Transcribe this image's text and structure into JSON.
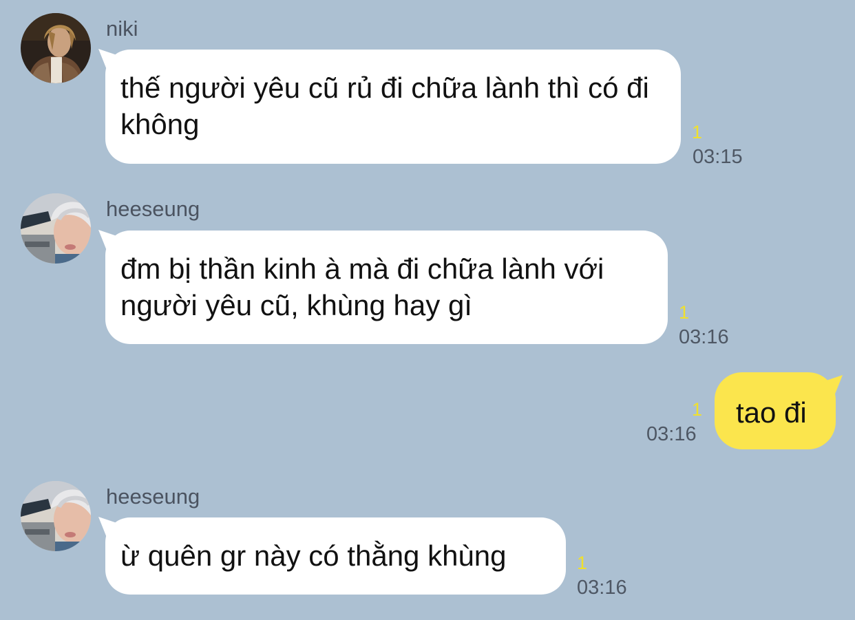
{
  "colors": {
    "background": "#acc0d2",
    "incoming_bubble": "#ffffff",
    "outgoing_bubble": "#fbe54d",
    "unread_count": "#f0e02c",
    "timestamp": "#4e5764"
  },
  "messages": [
    {
      "sender": "niki",
      "avatar_icon": "user-avatar-icon",
      "text": "thế người yêu cũ rủ đi chữa lành thì có đi không",
      "unread": "1",
      "time": "03:15"
    },
    {
      "sender": "heeseung",
      "avatar_icon": "user-avatar-icon",
      "text": "đm bị thần kinh à mà đi chữa lành với người yêu cũ, khùng hay gì",
      "unread": "1",
      "time": "03:16"
    },
    {
      "sender": "",
      "text": "tao đi",
      "unread": "1",
      "time": "03:16"
    },
    {
      "sender": "heeseung",
      "avatar_icon": "user-avatar-icon",
      "text": "ừ quên gr này có thằng khùng",
      "unread": "1",
      "time": "03:16"
    }
  ]
}
